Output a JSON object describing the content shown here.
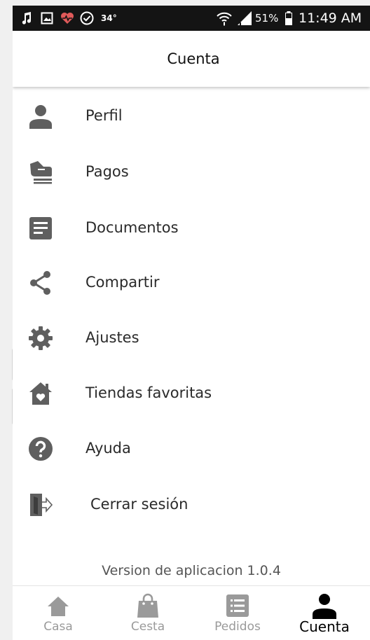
{
  "status_bar": {
    "temperature": "34°",
    "battery_percent": "51%",
    "time": "11:49 AM"
  },
  "header": {
    "title": "Cuenta"
  },
  "menu": {
    "items": [
      {
        "label": "Perfil",
        "icon": "person-icon"
      },
      {
        "label": "Pagos",
        "icon": "payment-hand-icon"
      },
      {
        "label": "Documentos",
        "icon": "document-icon"
      },
      {
        "label": "Compartir",
        "icon": "share-icon"
      },
      {
        "label": "Ajustes",
        "icon": "gear-icon"
      },
      {
        "label": "Tiendas favoritas",
        "icon": "favorite-store-icon"
      },
      {
        "label": "Ayuda",
        "icon": "help-icon"
      },
      {
        "label": "Cerrar sesión",
        "icon": "logout-icon"
      }
    ]
  },
  "version_text": "Version de aplicacion 1.0.4",
  "bottom_nav": {
    "items": [
      {
        "label": "Casa",
        "icon": "home-icon"
      },
      {
        "label": "Cesta",
        "icon": "bag-icon"
      },
      {
        "label": "Pedidos",
        "icon": "orders-icon"
      },
      {
        "label": "Cuenta",
        "icon": "person-icon",
        "active": true
      }
    ]
  },
  "colors": {
    "status_bar_bg": "#141414",
    "icon_gray": "#5f5f5f",
    "nav_inactive": "#9a9a9a",
    "nav_active": "#000000"
  }
}
